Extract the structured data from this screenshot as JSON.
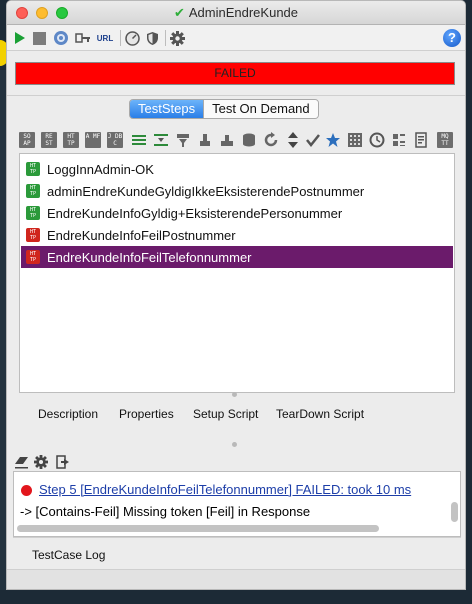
{
  "window": {
    "title": "AdminEndreKunde"
  },
  "toolbar": {
    "url_label": "URL",
    "help_label": "?"
  },
  "status": {
    "text": "FAILED",
    "color": "#ff0000"
  },
  "view_tabs": [
    {
      "label": "TestSteps",
      "active": true
    },
    {
      "label": "Test On Demand",
      "active": false
    }
  ],
  "step_toolbar": {
    "soap_label": "SO AP",
    "rest_label": "RE ST",
    "http_label": "HT TP",
    "amf_label": "A MF",
    "jdbc_label": "J DB C",
    "mqtt_label": "MQ TT"
  },
  "test_steps": [
    {
      "name": "LoggInnAdmin-OK",
      "status": "ok",
      "icon_text": "HT TP"
    },
    {
      "name": "adminEndreKundeGyldigIkkeEksisterendePostnummer",
      "status": "ok",
      "icon_text": "HT TP"
    },
    {
      "name": "EndreKundeInfoGyldig+EksisterendePersonummer",
      "status": "ok",
      "icon_text": "HT TP"
    },
    {
      "name": "EndreKundeInfoFeilPostnummer",
      "status": "fail",
      "icon_text": "HT TP"
    },
    {
      "name": "EndreKundeInfoFeilTelefonnummer",
      "status": "fail",
      "icon_text": "HT TP",
      "selected": true
    }
  ],
  "bottom_tabs": [
    "Description",
    "Properties",
    "Setup Script",
    "TearDown Script"
  ],
  "log": {
    "line1": "Step 5 [EndreKundeInfoFeilTelefonnummer] FAILED: took 10 ms",
    "line2": "-> [Contains-Feil] Missing token [Feil] in Response"
  },
  "log_tab": "TestCase Log",
  "colors": {
    "selected_row": "#6b1b6b",
    "ok_icon": "#2b9a3a",
    "fail_icon": "#d0261d",
    "tab_active": "#2a7ee8"
  }
}
